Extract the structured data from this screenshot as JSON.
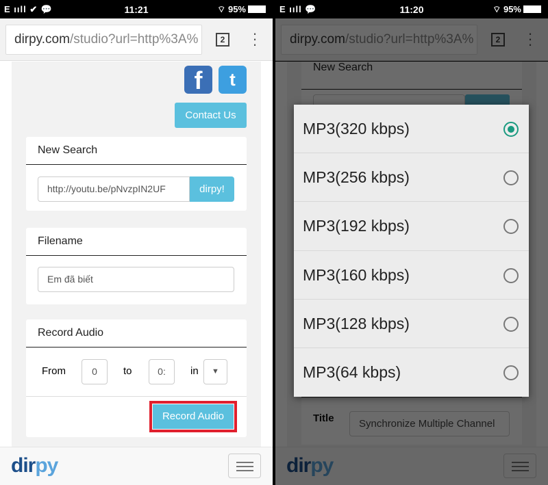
{
  "left": {
    "status": {
      "signal": "E ııll",
      "icons": "✔ 💬",
      "time": "11:21",
      "battery": "95%"
    },
    "browser": {
      "url_host": "dirpy.com",
      "url_path": "/studio?url=http%3A%",
      "tab_count": "2"
    },
    "social": {
      "facebook": "f",
      "twitter": "t"
    },
    "contact_label": "Contact Us",
    "new_search": {
      "title": "New Search",
      "url_value": "http://youtu.be/pNvzpIN2UF",
      "button": "dirpy!"
    },
    "filename": {
      "title": "Filename",
      "value": "Em đã biết"
    },
    "record": {
      "title": "Record Audio",
      "from_label": "From",
      "from_value": "0",
      "to_label": "to",
      "to_value": "0:",
      "in_label": "in",
      "button": "Record Audio"
    },
    "footer": {
      "logo_a": "dir",
      "logo_b": "py"
    }
  },
  "right": {
    "status": {
      "signal": "E ııll",
      "icons": "💬",
      "time": "11:20",
      "battery": "95%"
    },
    "browser": {
      "url_host": "dirpy.com",
      "url_path": "/studio?url=http%3A%",
      "tab_count": "2"
    },
    "new_search": {
      "title": "New Search"
    },
    "title_row": {
      "label": "Title",
      "value": "Synchronize Multiple Channel"
    },
    "footer": {
      "logo_a": "dir",
      "logo_b": "py"
    },
    "options": [
      {
        "label": "MP3(320 kbps)",
        "selected": true
      },
      {
        "label": "MP3(256 kbps)",
        "selected": false
      },
      {
        "label": "MP3(192 kbps)",
        "selected": false
      },
      {
        "label": "MP3(160 kbps)",
        "selected": false
      },
      {
        "label": "MP3(128 kbps)",
        "selected": false
      },
      {
        "label": "MP3(64 kbps)",
        "selected": false
      }
    ]
  },
  "colors": {
    "accent": "#5bc0de",
    "highlight": "#e0202e",
    "radio_selected": "#1a9a80"
  }
}
